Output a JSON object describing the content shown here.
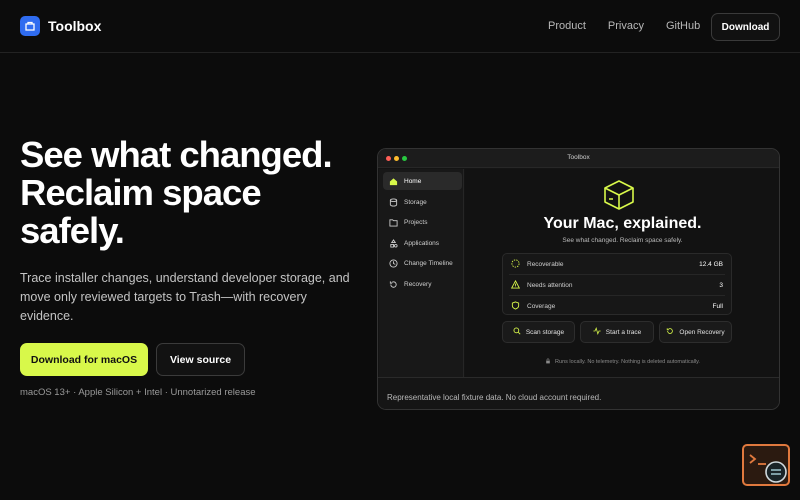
{
  "brand": {
    "name": "Toolbox"
  },
  "nav": {
    "links": [
      "Product",
      "Privacy",
      "GitHub"
    ],
    "download": "Download"
  },
  "hero": {
    "title_lines": [
      "See what changed.",
      "Reclaim space",
      "safely."
    ],
    "subtitle": "Trace installer changes, understand developer storage, and move only reviewed targets to Trash—with recovery evidence.",
    "primary_cta": "Download for macOS",
    "secondary_cta": "View source",
    "meta": "macOS 13+ · Apple Silicon + Intel · Unnotarized release"
  },
  "app": {
    "window_title": "Toolbox",
    "sidebar": [
      {
        "label": "Home",
        "icon": "home-icon",
        "active": true
      },
      {
        "label": "Storage",
        "icon": "database-icon"
      },
      {
        "label": "Projects",
        "icon": "folder-icon"
      },
      {
        "label": "Applications",
        "icon": "apps-icon"
      },
      {
        "label": "Change Timeline",
        "icon": "clock-icon"
      },
      {
        "label": "Recovery",
        "icon": "recovery-icon"
      }
    ],
    "main": {
      "title": "Your Mac, explained.",
      "subtitle": "See what changed. Reclaim space safely.",
      "stats": [
        {
          "label": "Recoverable",
          "value": "12.4 GB",
          "icon": "dashed-circle-icon"
        },
        {
          "label": "Needs attention",
          "value": "3",
          "icon": "warning-icon"
        },
        {
          "label": "Coverage",
          "value": "Full",
          "icon": "shield-icon"
        }
      ],
      "actions": [
        {
          "label": "Scan storage",
          "icon": "search-icon"
        },
        {
          "label": "Start a trace",
          "icon": "pulse-icon"
        },
        {
          "label": "Open Recovery",
          "icon": "recovery-icon"
        }
      ],
      "footnote": "Runs locally. No telemetry. Nothing is deleted automatically."
    },
    "footer": "Representative local fixture data. No cloud account required."
  },
  "colors": {
    "accent": "#d8f84a",
    "background": "#0c0c0c",
    "brand_blue": "#2f6cf0",
    "widget_orange": "#e0793e"
  }
}
